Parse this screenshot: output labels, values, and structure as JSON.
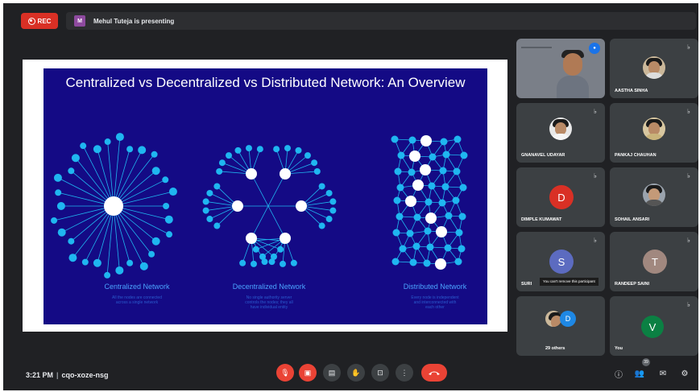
{
  "recording": {
    "label": "REC"
  },
  "presenter": {
    "initial": "M",
    "text": "Mehul Tuteja is presenting"
  },
  "slide": {
    "title": "Centralized vs Decentralized vs Distributed Network: An Overview",
    "panels": [
      {
        "caption": "Centralized Network",
        "subcaption": "All the nodes are connected\nacross a single network"
      },
      {
        "caption": "Decentralized Network",
        "subcaption": "No single authority server\ncontrols the nodes; they all\nhave individual entity"
      },
      {
        "caption": "Distributed Network",
        "subcaption": "Every node is independent\nand interconnected with\neach other"
      }
    ]
  },
  "participants": [
    {
      "name": "",
      "kind": "video-self-speaking"
    },
    {
      "name": "AASTHA SINHA",
      "kind": "photo"
    },
    {
      "name": "GNANAVEL UDAYAR",
      "kind": "photo"
    },
    {
      "name": "PANKAJ CHAUHAN",
      "kind": "photo"
    },
    {
      "name": "DIMPLE KUMAWAT",
      "kind": "initial",
      "initial": "D",
      "color": "#d93025"
    },
    {
      "name": "SOHAIL ANSARI",
      "kind": "photo"
    },
    {
      "name": "SURI",
      "kind": "initial",
      "initial": "S",
      "color": "#5c6bc0"
    },
    {
      "name": "RANDEEP SAINI",
      "kind": "initial",
      "initial": "T",
      "color": "#a1887f"
    },
    {
      "name": "29 others",
      "kind": "group",
      "initial": "D",
      "color": "#1e88e5"
    },
    {
      "name": "You",
      "kind": "initial",
      "initial": "V",
      "color": "#0b8043"
    }
  ],
  "tooltip": "You can't remove this participant",
  "bottom": {
    "time": "3:21 PM",
    "separator": "|",
    "meeting_code": "cqo-xoze-nsg",
    "people_count": "39"
  },
  "colors": {
    "slide_bg": "#140a85",
    "node": "#1fb6f0",
    "hub": "#ffffff",
    "accent_red": "#ea4335"
  }
}
